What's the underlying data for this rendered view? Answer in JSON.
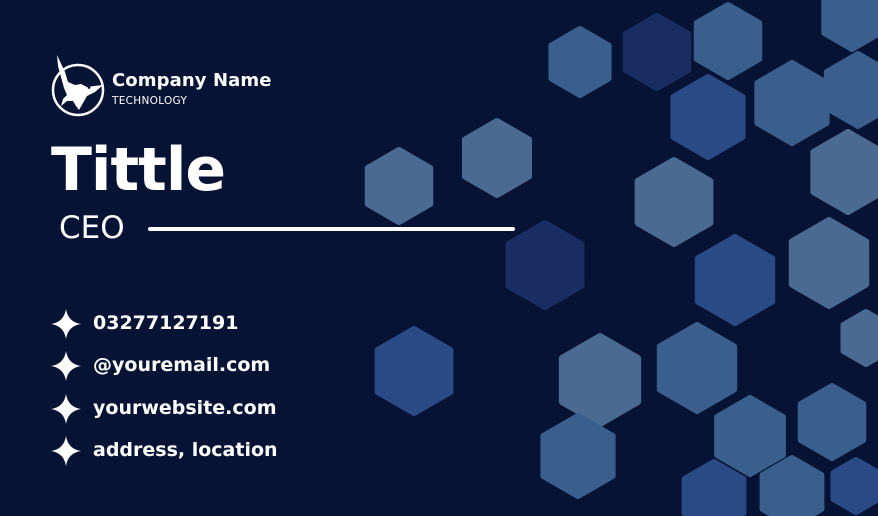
{
  "company": {
    "name": "Company Name",
    "tagline": "TECHNOLOGY"
  },
  "person": {
    "title": "Tittle",
    "role": "CEO"
  },
  "contacts": [
    {
      "icon": "sparkle-icon",
      "text": "03277127191"
    },
    {
      "icon": "sparkle-icon",
      "text": "@youremail.com"
    },
    {
      "icon": "sparkle-icon",
      "text": "yourwebsite.com"
    },
    {
      "icon": "sparkle-icon",
      "text": "address, location"
    }
  ],
  "colors": {
    "background": "#061334",
    "text": "#ffffff",
    "hex_light": "#4a6a92",
    "hex_mid": "#3a5f8c",
    "hex_blue": "#2a4a86",
    "hex_dark": "#1a2d62"
  },
  "logo": {
    "icon": "eagle-icon"
  },
  "decoration": {
    "pattern": "hexagon-pattern"
  }
}
